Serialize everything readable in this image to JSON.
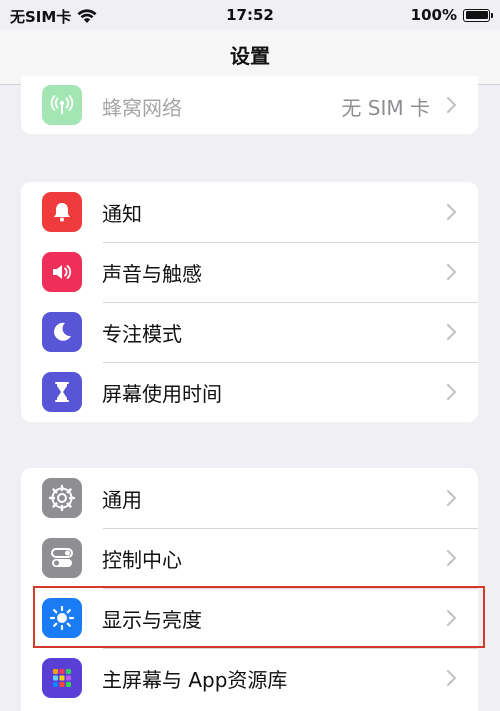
{
  "status_bar": {
    "carrier": "无SIM卡",
    "time": "17:52",
    "battery_percent": "100%"
  },
  "nav": {
    "title": "设置"
  },
  "group_top": {
    "cellular": {
      "label": "蜂窝网络",
      "value": "无 SIM 卡",
      "icon": "cellular-antenna-icon",
      "color": "#34c759"
    }
  },
  "group_middle": {
    "items": [
      {
        "label": "通知",
        "icon": "bell-icon",
        "color": "#ef3b3b"
      },
      {
        "label": "声音与触感",
        "icon": "speaker-icon",
        "color": "#ef2f58"
      },
      {
        "label": "专注模式",
        "icon": "moon-icon",
        "color": "#5856d6"
      },
      {
        "label": "屏幕使用时间",
        "icon": "hourglass-icon",
        "color": "#5856d6"
      }
    ]
  },
  "group_bottom": {
    "items": [
      {
        "label": "通用",
        "icon": "gear-icon",
        "color": "#8e8e93"
      },
      {
        "label": "控制中心",
        "icon": "toggles-icon",
        "color": "#8e8e93"
      },
      {
        "label": "显示与亮度",
        "icon": "sun-icon",
        "color": "#1a7cf5"
      },
      {
        "label": "主屏幕与 App资源库",
        "icon": "app-grid-icon",
        "color": "#5a3fd6"
      }
    ]
  }
}
